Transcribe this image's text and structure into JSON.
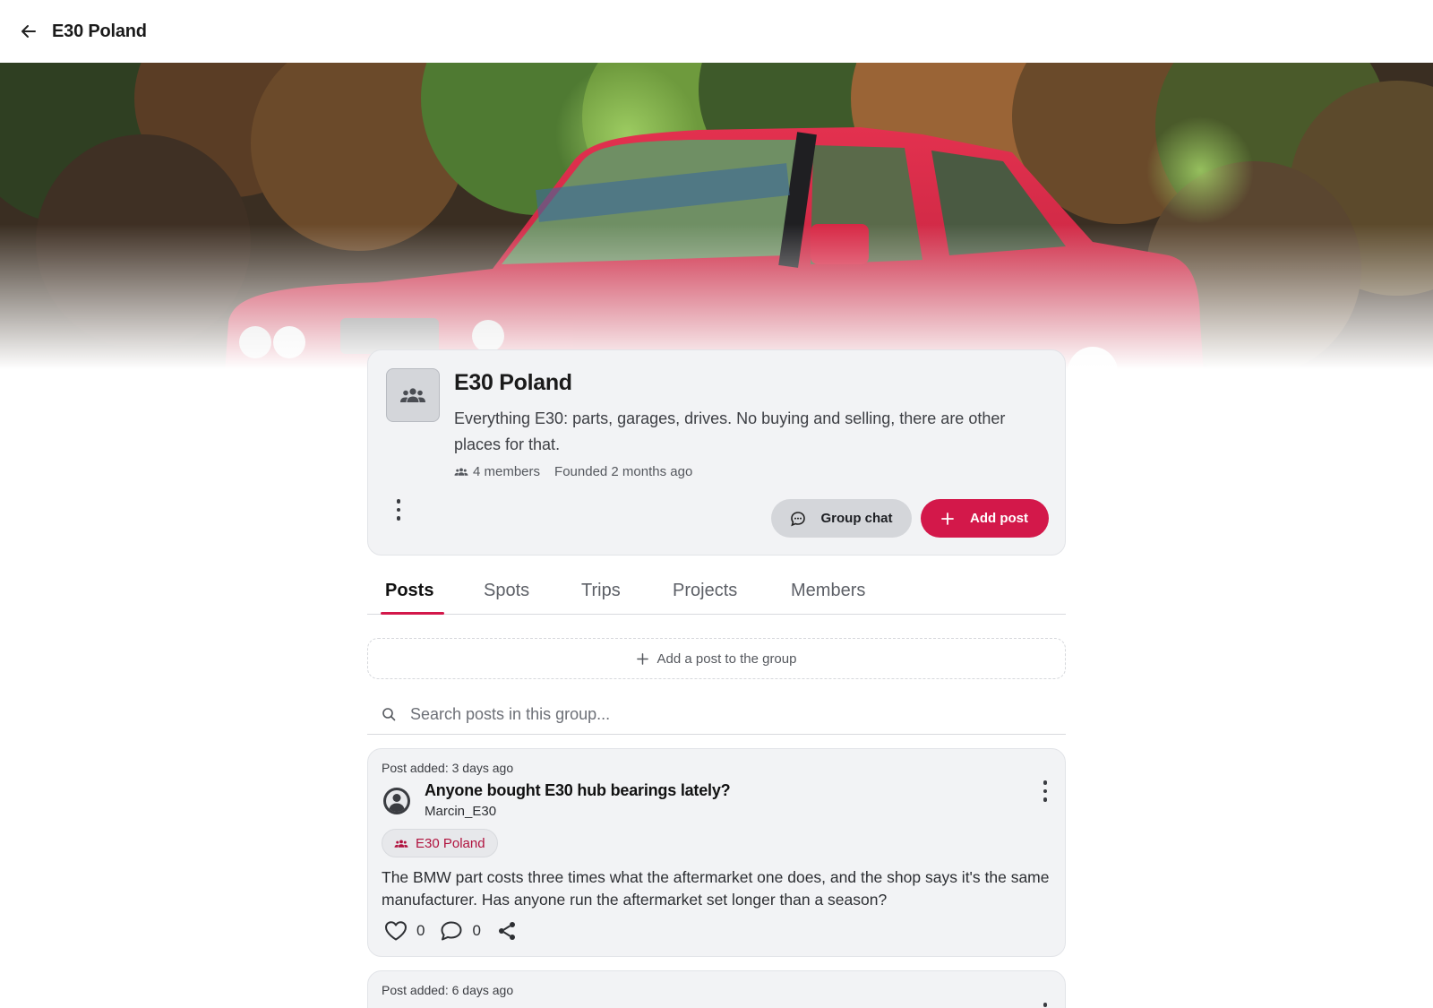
{
  "topbar": {
    "title": "E30 Poland"
  },
  "group": {
    "name": "E30 Poland",
    "description": "Everything E30: parts, garages, drives. No buying and selling, there are other places for that.",
    "members": "4 members",
    "founded": "Founded 2 months ago",
    "chat_label": "Group chat",
    "add_post_label": "Add post"
  },
  "tabs": [
    {
      "label": "Posts",
      "active": true
    },
    {
      "label": "Spots",
      "active": false
    },
    {
      "label": "Trips",
      "active": false
    },
    {
      "label": "Projects",
      "active": false
    },
    {
      "label": "Members",
      "active": false
    }
  ],
  "add_post_bar": {
    "label": "Add a post to the group"
  },
  "search": {
    "placeholder": "Search posts in this group..."
  },
  "posts": [
    {
      "added": "Post added: 3 days ago",
      "title": "Anyone bought E30 hub bearings lately?",
      "author": "Marcin_E30",
      "group": "E30 Poland",
      "body": "The BMW part costs three times what the aftermarket one does, and the shop says it's the same manufacturer. Has anyone run the aftermarket set longer than a season?",
      "likes": "0",
      "comments": "0"
    },
    {
      "added": "Post added: 6 days ago"
    }
  ],
  "icons": {
    "back": "arrow-left-icon",
    "group": "group-icon",
    "chat": "chat-bubble-icon",
    "plus": "plus-icon",
    "search": "search-icon",
    "like": "heart-icon",
    "comment": "comment-icon",
    "share": "share-icon",
    "more": "more-vertical-icon"
  },
  "colors": {
    "accent": "#d3184a",
    "chip_text": "#b0123e",
    "card_bg": "#f2f3f5"
  }
}
